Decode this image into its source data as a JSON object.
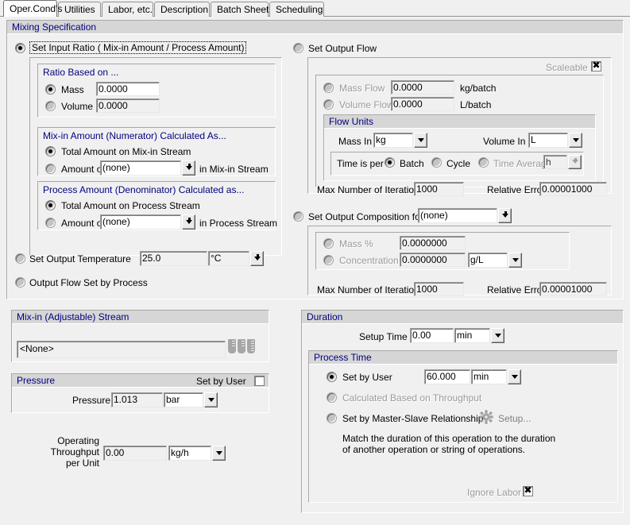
{
  "tabs": [
    {
      "label": "Oper.Cond's",
      "active": true
    },
    {
      "label": "Utilities",
      "active": false
    },
    {
      "label": "Labor, etc.",
      "active": false
    },
    {
      "label": "Description",
      "active": false
    },
    {
      "label": "Batch Sheet",
      "active": false
    },
    {
      "label": "Scheduling",
      "active": false
    }
  ],
  "mixing": {
    "title": "Mixing Specification",
    "set_input_ratio": "Set Input Ratio ( Mix-in Amount / Process Amount)",
    "ratio_based_on": "Ratio Based on ...",
    "mass_label": "Mass",
    "mass_value": "0.0000",
    "volume_label": "Volume",
    "volume_value": "0.0000",
    "numerator_title": "Mix-in Amount (Numerator) Calculated As...",
    "numerator_total": "Total Amount on Mix-in Stream",
    "numerator_amount_of": "Amount of",
    "numerator_component": "(none)",
    "numerator_suffix": "in Mix-in Stream",
    "denominator_title": "Process Amount (Denominator) Calculated as...",
    "denominator_total": "Total Amount on Process Stream",
    "denominator_amount_of": "Amount of",
    "denominator_component": "(none)",
    "denominator_suffix": "in Process Stream",
    "set_output_temperature": "Set Output Temperature",
    "temperature_value": "25.0",
    "temperature_unit": "°C",
    "output_flow_set_by_process": "Output Flow Set by Process"
  },
  "output_flow": {
    "title": "Set Output Flow",
    "scaleable_label": "Scaleable",
    "scaleable_checked": true,
    "mass_flow_label": "Mass Flow",
    "mass_flow_value": "0.0000",
    "mass_flow_unit": "kg/batch",
    "volume_flow_label": "Volume Flow",
    "volume_flow_value": "0.0000",
    "volume_flow_unit": "L/batch",
    "flow_units_title": "Flow Units",
    "mass_in_label": "Mass In",
    "mass_in_value": "kg",
    "volume_in_label": "Volume In",
    "volume_in_value": "L",
    "time_is_per_label": "Time is per",
    "batch_label": "Batch",
    "cycle_label": "Cycle",
    "time_average_label": "Time Average",
    "time_average_value": "h",
    "max_iterations_label": "Max Number of Iterations",
    "max_iterations_value": "1000",
    "relative_error_label": "Relative Error",
    "relative_error_value": "0.00001000"
  },
  "output_composition": {
    "title": "Set Output Composition for",
    "component": "(none)",
    "mass_pct_label": "Mass %",
    "mass_pct_value": "0.0000000",
    "concentration_label": "Concentration",
    "concentration_value": "0.0000000",
    "concentration_unit": "g/L",
    "max_iterations_label": "Max Number of Iterations",
    "max_iterations_value": "1000",
    "relative_error_label": "Relative Error",
    "relative_error_value": "0.00001000"
  },
  "mixin_stream": {
    "title": "Mix-in (Adjustable) Stream",
    "value": "<None>"
  },
  "pressure": {
    "title": "Pressure",
    "set_by_user_label": "Set by User",
    "set_by_user_checked": false,
    "pressure_label": "Pressure",
    "pressure_value": "1.013",
    "pressure_unit": "bar"
  },
  "throughput": {
    "label_line1": "Operating",
    "label_line2": "Throughput",
    "label_line3": "per Unit",
    "value": "0.00",
    "unit": "kg/h"
  },
  "duration": {
    "title": "Duration",
    "setup_time_label": "Setup Time",
    "setup_time_value": "0.00",
    "setup_time_unit": "min",
    "process_time_title": "Process Time",
    "set_by_user_label": "Set by User",
    "process_time_value": "60.000",
    "process_time_unit": "min",
    "calculated_label": "Calculated Based on Throughput",
    "master_slave_label": "Set by Master-Slave Relationship",
    "setup_button_label": "Setup...",
    "description_line1": "Match the duration of this operation to the duration",
    "description_line2": "of another operation or string of operations.",
    "ignore_labor_label": "Ignore Labor",
    "ignore_labor_checked": true
  },
  "colors": {
    "legend_blue": "#000080",
    "panel_bg": "#f0f0f0",
    "bar_bg": "#d6d6d6",
    "disabled_text": "#9a9a9a"
  }
}
